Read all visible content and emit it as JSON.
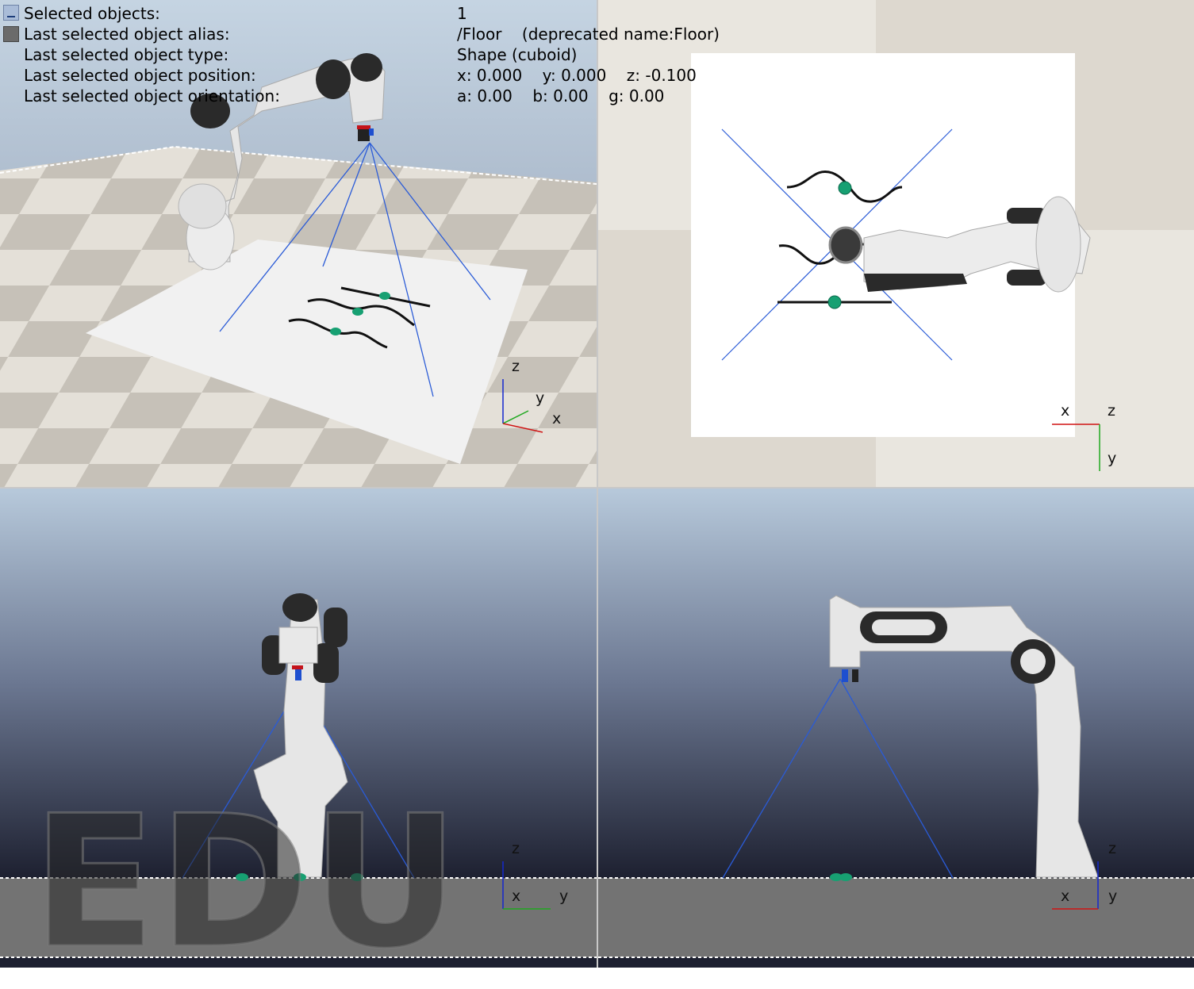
{
  "info": {
    "rows": [
      {
        "label": "Selected objects:",
        "value": "1"
      },
      {
        "label": "Last selected object alias:",
        "value": "/Floor    (deprecated name:Floor)"
      },
      {
        "label": "Last selected object type:",
        "value": "Shape (cuboid)"
      },
      {
        "label": "Last selected object position:",
        "value": "x: 0.000    y: 0.000    z: -0.100"
      },
      {
        "label": "Last selected object orientation:",
        "value": "a: 0.00    b: 0.00    g: 0.00"
      }
    ]
  },
  "viewports": {
    "perspective": {
      "axes": {
        "z": "z",
        "y": "y",
        "x": "x"
      }
    },
    "top": {
      "axes": {
        "x": "x",
        "z": "z",
        "y": "y"
      }
    },
    "front": {
      "axes": {
        "z": "z",
        "x": "x",
        "y": "y"
      }
    },
    "side": {
      "axes": {
        "z": "z",
        "x": "x",
        "y": "y"
      }
    }
  },
  "watermark": "EDU",
  "colors": {
    "sky_top": "#b9cbdc",
    "sky_bottom": "#1d2030",
    "floor_light": "#e7e3dc",
    "floor_dark": "#c9c4bc",
    "ground_grey": "#737373",
    "sensor_line": "#2a5bd7",
    "marker_green": "#17a072",
    "robot_white": "#e8e8e8",
    "robot_black": "#2a2a2a"
  }
}
